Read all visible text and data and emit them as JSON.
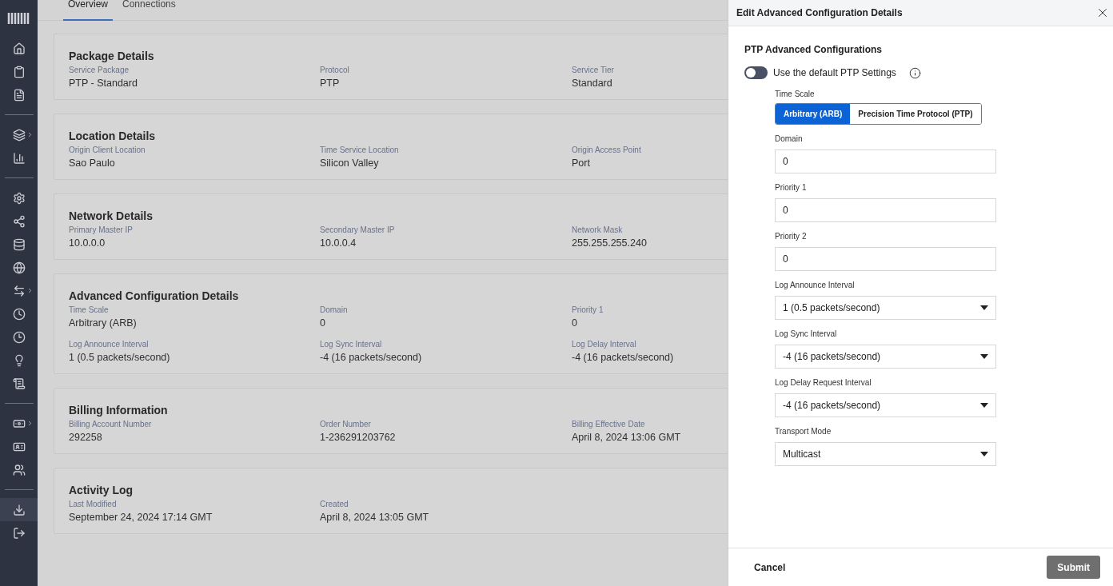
{
  "sidebar": {
    "groups": [
      {
        "items": [
          {
            "expandable": false,
            "selected": false
          },
          {
            "expandable": false,
            "selected": false
          },
          {
            "expandable": false,
            "selected": false
          }
        ]
      },
      {
        "items": [
          {
            "expandable": true,
            "selected": false
          },
          {
            "expandable": false,
            "selected": false
          }
        ]
      },
      {
        "items": [
          {
            "expandable": false,
            "selected": false
          },
          {
            "expandable": false,
            "selected": false
          },
          {
            "expandable": false,
            "selected": false
          },
          {
            "expandable": false,
            "selected": false
          },
          {
            "expandable": true,
            "selected": false
          },
          {
            "expandable": false,
            "selected": false
          },
          {
            "expandable": false,
            "selected": false
          },
          {
            "expandable": false,
            "selected": false
          },
          {
            "expandable": false,
            "selected": false
          }
        ]
      },
      {
        "items": [
          {
            "expandable": true,
            "selected": false
          },
          {
            "expandable": false,
            "selected": false
          },
          {
            "expandable": false,
            "selected": false
          }
        ]
      },
      {
        "items": [
          {
            "expandable": false,
            "selected": true
          },
          {
            "expandable": false,
            "selected": false
          }
        ]
      }
    ]
  },
  "tabs": [
    {
      "label": "Overview",
      "selected": true
    },
    {
      "label": "Connections",
      "selected": false
    }
  ],
  "cards": [
    {
      "title": "Package Details",
      "fields": [
        {
          "label": "Service Package",
          "value": "PTP - Standard"
        },
        {
          "label": "Protocol",
          "value": "PTP"
        },
        {
          "label": "Service Tier",
          "value": "Standard"
        }
      ]
    },
    {
      "title": "Location Details",
      "fields": [
        {
          "label": "Origin Client Location",
          "value": "Sao Paulo"
        },
        {
          "label": "Time Service Location",
          "value": "Silicon Valley"
        },
        {
          "label": "Origin Access Point",
          "value": "Port"
        }
      ]
    },
    {
      "title": "Network Details",
      "fields": [
        {
          "label": "Primary Master IP",
          "value": "10.0.0.0"
        },
        {
          "label": "Secondary Master IP",
          "value": "10.0.0.4"
        },
        {
          "label": "Network Mask",
          "value": "255.255.255.240"
        }
      ]
    },
    {
      "title": "Advanced Configuration Details",
      "fields": [
        {
          "label": "Time Scale",
          "value": "Arbitrary (ARB)"
        },
        {
          "label": "Domain",
          "value": "0"
        },
        {
          "label": "Priority 1",
          "value": "0"
        },
        {
          "label": "Log Announce Interval",
          "value": "1 (0.5 packets/second)"
        },
        {
          "label": "Log Sync Interval",
          "value": "-4 (16 packets/second)"
        },
        {
          "label": "Log Delay Interval",
          "value": "-4 (16 packets/second)"
        }
      ]
    },
    {
      "title": "Billing Information",
      "fields": [
        {
          "label": "Billing Account Number",
          "value": "292258"
        },
        {
          "label": "Order Number",
          "value": "1-236291203762"
        },
        {
          "label": "Billing Effective Date",
          "value": "April 8, 2024 13:06 GMT"
        }
      ]
    },
    {
      "title": "Activity Log",
      "fields": [
        {
          "label": "Last Modified",
          "value": "September 24, 2024 17:14 GMT"
        },
        {
          "label": "Created",
          "value": "April 8, 2024 13:05 GMT"
        }
      ]
    }
  ],
  "drawer": {
    "title": "Edit Advanced Configuration Details",
    "section_title": "PTP Advanced Configurations",
    "toggle": {
      "label": "Use the default PTP Settings",
      "on": false
    },
    "time_scale": {
      "label": "Time Scale",
      "options": [
        {
          "label": "Arbitrary (ARB)",
          "selected": true
        },
        {
          "label": "Precision Time Protocol (PTP)",
          "selected": false
        }
      ]
    },
    "fields": [
      {
        "kind": "text",
        "label": "Domain",
        "value": "0"
      },
      {
        "kind": "text",
        "label": "Priority 1",
        "value": "0"
      },
      {
        "kind": "text",
        "label": "Priority 2",
        "value": "0"
      },
      {
        "kind": "select",
        "label": "Log Announce Interval",
        "value": "1 (0.5 packets/second)"
      },
      {
        "kind": "select",
        "label": "Log Sync Interval",
        "value": "-4 (16 packets/second)"
      },
      {
        "kind": "select",
        "label": "Log Delay Request Interval",
        "value": "-4 (16 packets/second)"
      },
      {
        "kind": "select",
        "label": "Transport Mode",
        "value": "Multicast"
      }
    ],
    "cancel": "Cancel",
    "submit": "Submit"
  }
}
